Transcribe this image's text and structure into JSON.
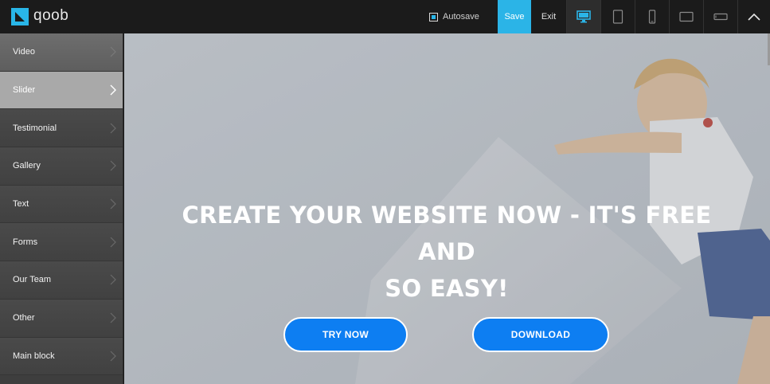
{
  "app": {
    "logo_text": "qoob"
  },
  "toolbar": {
    "autosave_label": "Autosave",
    "autosave_checked": true,
    "save_label": "Save",
    "exit_label": "Exit",
    "devices": [
      "desktop-icon",
      "tablet-portrait-icon",
      "phone-portrait-icon",
      "tablet-landscape-icon",
      "phone-landscape-icon"
    ],
    "active_device": "desktop-icon",
    "collapse_icon": "chevron-up-icon"
  },
  "sidebar": {
    "items": [
      {
        "label": "Video"
      },
      {
        "label": "Slider"
      },
      {
        "label": "Testimonial"
      },
      {
        "label": "Gallery"
      },
      {
        "label": "Text"
      },
      {
        "label": "Forms"
      },
      {
        "label": "Our Team"
      },
      {
        "label": "Other"
      },
      {
        "label": "Main block"
      }
    ],
    "active_index": 1
  },
  "preview": {
    "headline_line1": "CREATE YOUR WEBSITE NOW - IT'S FREE AND",
    "headline_line2": "SO EASY!",
    "try_now": "TRY NOW",
    "download": "DOWNLOAD"
  },
  "colors": {
    "accent": "#2bb4e7",
    "cta": "#0d7ef2",
    "topbar": "#1b1b1b",
    "sidebar": "#444444",
    "sidebar_active": "#a9a9a9"
  }
}
